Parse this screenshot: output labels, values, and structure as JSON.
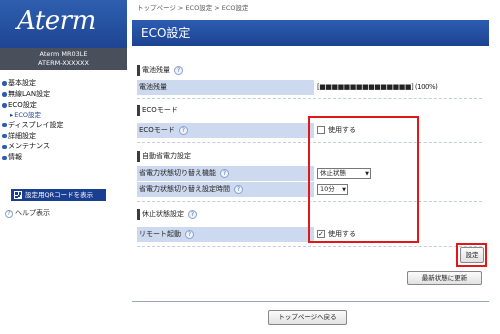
{
  "sidebar": {
    "logo": "Aterm",
    "model_line1": "Aterm MR03LE",
    "model_line2": "ATERM-XXXXXX",
    "items": [
      {
        "label": "基本設定"
      },
      {
        "label": "無線LAN設定"
      },
      {
        "label": "ECO設定"
      },
      {
        "label": "ディスプレイ設定"
      },
      {
        "label": "詳細設定"
      },
      {
        "label": "メンテナンス"
      },
      {
        "label": "情報"
      }
    ],
    "sub_item": "ECO設定",
    "qr_button": "設定用QRコードを表示",
    "help": "ヘルプ表示"
  },
  "breadcrumb": "トップページ > ECO設定 > ECO設定",
  "page_title": "ECO設定",
  "sections": {
    "battery": {
      "heading": "電池残量",
      "label": "電池残量",
      "value": "[■■■■■■■■■■■■■■■] (100%)"
    },
    "eco_mode": {
      "heading": "ECOモード",
      "label": "ECOモード",
      "checkbox_label": "使用する",
      "checked": false
    },
    "auto_power": {
      "heading": "自動省電力設定",
      "func_label": "省電力状態切り替え機能",
      "func_value": "休止状態",
      "time_label": "省電力状態切り替え設定時間",
      "time_value": "10分"
    },
    "sleep": {
      "heading": "休止状態設定",
      "label": "リモート起動",
      "checkbox_label": "使用する",
      "checked": true
    }
  },
  "help_glyph": "?",
  "buttons": {
    "apply": "設定",
    "refresh": "最新状態に更新",
    "back_top": "トップページへ戻る"
  },
  "colors": {
    "brand_blue": "#1c4391",
    "row_bg": "#cdd9ee",
    "highlight_red": "#e01818"
  }
}
